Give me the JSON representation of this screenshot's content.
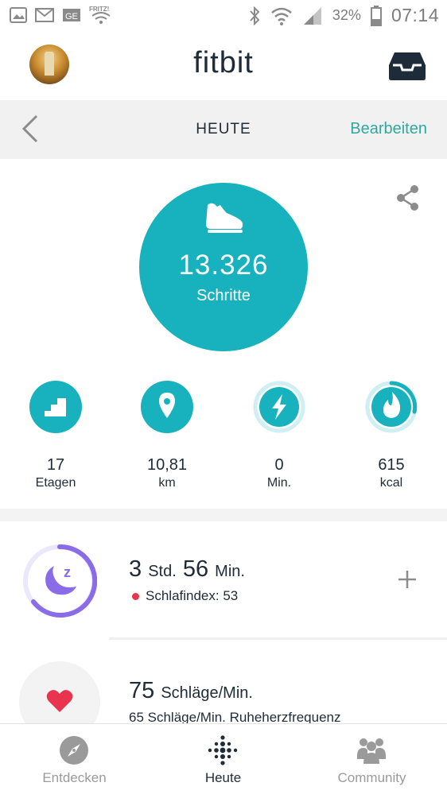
{
  "status_bar": {
    "battery": "32%",
    "time": "07:14"
  },
  "header": {
    "brand": "fitbit"
  },
  "subbar": {
    "title": "HEUTE",
    "edit_label": "Bearbeiten"
  },
  "steps": {
    "value": "13.326",
    "label": "Schritte"
  },
  "stats": [
    {
      "value": "17",
      "unit": "Etagen",
      "icon": "stairs-icon"
    },
    {
      "value": "10,81",
      "unit": "km",
      "icon": "location-pin-icon"
    },
    {
      "value": "0",
      "unit": "Min.",
      "icon": "lightning-icon"
    },
    {
      "value": "615",
      "unit": "kcal",
      "icon": "flame-icon"
    }
  ],
  "sleep": {
    "hours": "3",
    "hours_unit": "Std.",
    "minutes": "56",
    "minutes_unit": "Min.",
    "score_text": "Schlafindex: 53"
  },
  "heart": {
    "value": "75",
    "unit": "Schläge/Min.",
    "resting_text": "65 Schläge/Min. Ruheherzfrequenz"
  },
  "bottom_nav": [
    {
      "label": "Entdecken",
      "icon": "compass-icon"
    },
    {
      "label": "Heute",
      "icon": "fitbit-dots-icon"
    },
    {
      "label": "Community",
      "icon": "community-icon"
    }
  ],
  "colors": {
    "teal": "#17b2bd",
    "teal_light": "#cfeff2",
    "purple": "#8a6be8",
    "red": "#e8344e",
    "link": "#30a8a0"
  }
}
